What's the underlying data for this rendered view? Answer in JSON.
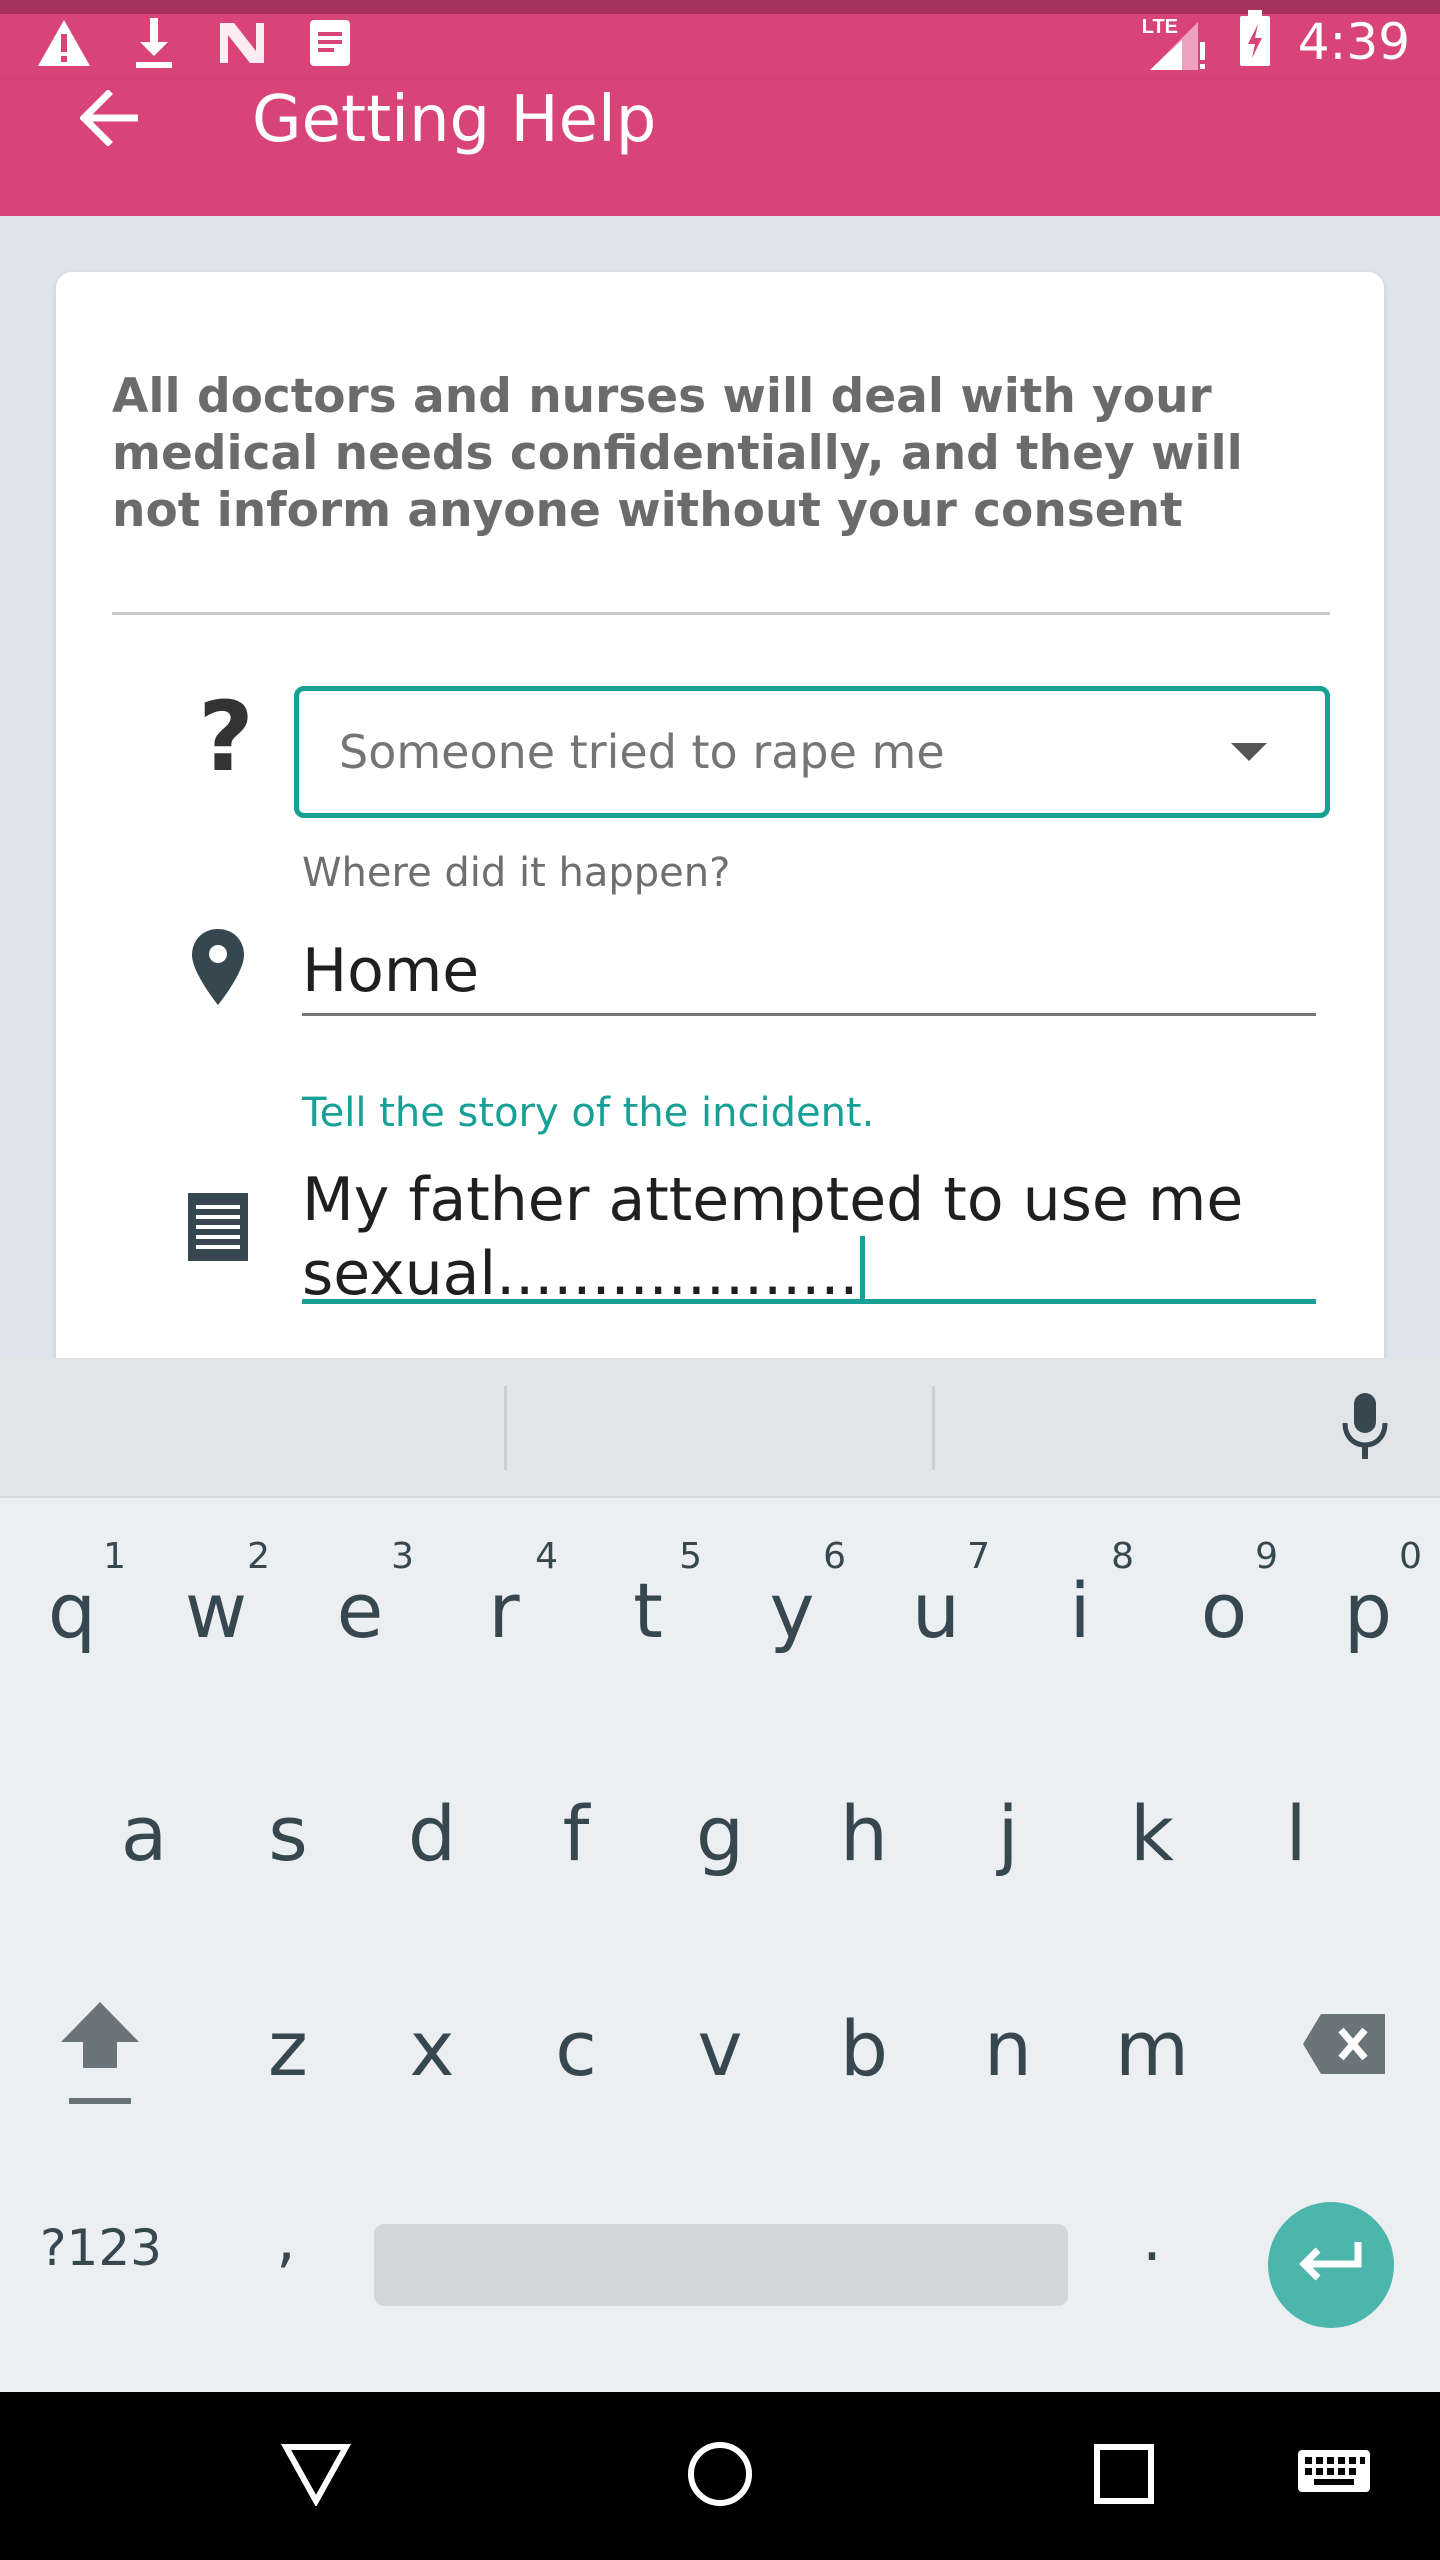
{
  "status_bar": {
    "time": "4:39",
    "network": "LTE",
    "icons": [
      "warning-icon",
      "download-icon",
      "n-icon",
      "note-icon",
      "signal-icon",
      "battery-icon"
    ]
  },
  "app_bar": {
    "title": "Getting Help",
    "back_icon": "arrow-left-icon"
  },
  "form": {
    "notice": "All doctors and nurses will deal with your medical needs confidentially, and they will not inform anyone without your consent",
    "incident_type": {
      "icon": "question-icon",
      "question_mark": "?",
      "selected": "Someone tried to rape me"
    },
    "location": {
      "label": "Where did it happen?",
      "value": "Home",
      "icon": "location-pin-icon"
    },
    "story": {
      "label": "Tell the story of the incident.",
      "value": "My father attempted to use me sexual...................",
      "icon": "document-icon"
    }
  },
  "keyboard": {
    "row1": [
      {
        "ch": "q",
        "hint": "1"
      },
      {
        "ch": "w",
        "hint": "2"
      },
      {
        "ch": "e",
        "hint": "3"
      },
      {
        "ch": "r",
        "hint": "4"
      },
      {
        "ch": "t",
        "hint": "5"
      },
      {
        "ch": "y",
        "hint": "6"
      },
      {
        "ch": "u",
        "hint": "7"
      },
      {
        "ch": "i",
        "hint": "8"
      },
      {
        "ch": "o",
        "hint": "9"
      },
      {
        "ch": "p",
        "hint": "0"
      }
    ],
    "row2": [
      "a",
      "s",
      "d",
      "f",
      "g",
      "h",
      "j",
      "k",
      "l"
    ],
    "row3": [
      "z",
      "x",
      "c",
      "v",
      "b",
      "n",
      "m"
    ],
    "symbols_label": "?123",
    "comma": ",",
    "period": "."
  },
  "colors": {
    "app_bar": "#d84478",
    "accent": "#17a096",
    "enter_key": "#4db6ac"
  }
}
